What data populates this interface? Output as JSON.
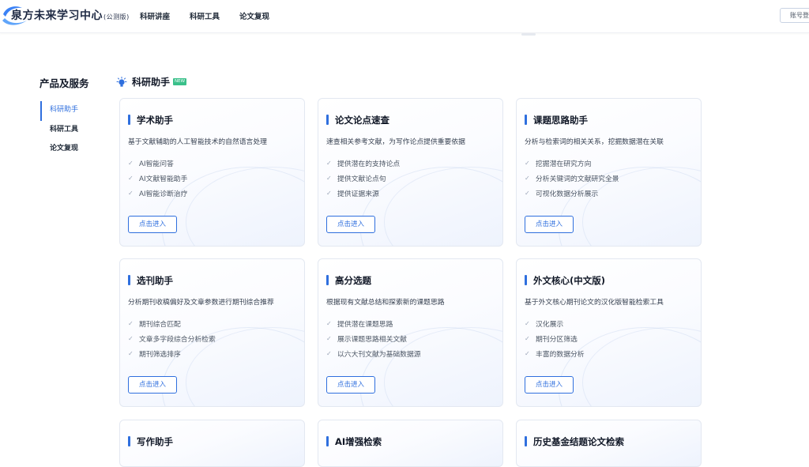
{
  "header": {
    "logo_text": "泉方未来学习中心",
    "logo_sub": "(公测版)",
    "nav": [
      "科研讲座",
      "科研工具",
      "论文复现"
    ],
    "login_label": "账号登录"
  },
  "sidebar": {
    "title": "产品及服务",
    "items": [
      {
        "label": "科研助手",
        "active": true
      },
      {
        "label": "科研工具",
        "active": false
      },
      {
        "label": "论文复现",
        "active": false
      }
    ]
  },
  "section": {
    "title": "科研助手",
    "badge": "NEW",
    "icon": "bulb-icon"
  },
  "cards": [
    {
      "title": "学术助手",
      "desc": "基于文献辅助的人工智能技术的自然语言处理",
      "features": [
        "AI智能问答",
        "AI文献智能助手",
        "AI智能诊断治疗"
      ],
      "button": "点击进入"
    },
    {
      "title": "论文论点速查",
      "desc": "速查相关参考文献，为写作论点提供重要依据",
      "features": [
        "提供潜在的支持论点",
        "提供文献论点句",
        "提供证据来源"
      ],
      "button": "点击进入"
    },
    {
      "title": "课题思路助手",
      "desc": "分析与检索词的相关关系，挖掘数据潜在关联",
      "features": [
        "挖掘潜在研究方向",
        "分析关键词的文献研究全景",
        "可视化数据分析展示"
      ],
      "button": "点击进入"
    },
    {
      "title": "选刊助手",
      "desc": "分析期刊收稿偏好及文章参数进行期刊综合推荐",
      "features": [
        "期刊综合匹配",
        "文章多字段综合分析检索",
        "期刊筛选排序"
      ],
      "button": "点击进入"
    },
    {
      "title": "高分选题",
      "desc": "根据现有文献总结和探索新的课题思路",
      "features": [
        "提供潜在课题思路",
        "展示课题思路相关文献",
        "以六大刊文献为基础数据源"
      ],
      "button": "点击进入"
    },
    {
      "title": "外文核心(中文版)",
      "desc": "基于外文核心期刊论文的汉化版智能检索工具",
      "features": [
        "汉化展示",
        "期刊分区筛选",
        "丰富的数据分析"
      ],
      "button": "点击进入"
    },
    {
      "title": "写作助手",
      "desc": "",
      "features": [],
      "button": ""
    },
    {
      "title": "AI增强检索",
      "desc": "",
      "features": [],
      "button": ""
    },
    {
      "title": "历史基金结题论文检索",
      "desc": "",
      "features": [],
      "button": ""
    }
  ],
  "colors": {
    "accent": "#2f6fde",
    "badge": "#3ac08a"
  }
}
